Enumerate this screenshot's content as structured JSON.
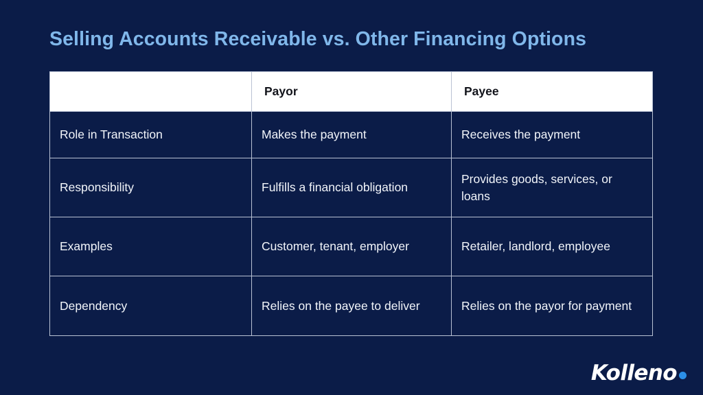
{
  "slide": {
    "title": "Selling Accounts Receivable vs. Other Financing Options",
    "background_color": "#0b1c48",
    "title_color": "#80b7ea"
  },
  "table": {
    "header_background": "#ffffff",
    "header_text_color": "#12131a",
    "border_color": "#b9c2d4",
    "body_text_color": "#f2f5fa",
    "columns": [
      {
        "key": "attribute",
        "label": ""
      },
      {
        "key": "payor",
        "label": "Payor"
      },
      {
        "key": "payee",
        "label": "Payee"
      }
    ],
    "rows": [
      {
        "attribute": "Role in Transaction",
        "payor": "Makes the payment",
        "payee": "Receives the payment"
      },
      {
        "attribute": "Responsibility",
        "payor": "Fulfills a financial obligation",
        "payee": "Provides goods, services, or loans"
      },
      {
        "attribute": "Examples",
        "payor": "Customer, tenant, employer",
        "payee": "Retailer, landlord, employee"
      },
      {
        "attribute": "Dependency",
        "payor": "Relies on the payee to deliver",
        "payee": "Relies on the payor for payment"
      }
    ]
  },
  "logo": {
    "word": "Kolleno",
    "dot_icon": "dot-icon",
    "dot_color": "#2b8fe8",
    "word_color": "#ffffff"
  }
}
